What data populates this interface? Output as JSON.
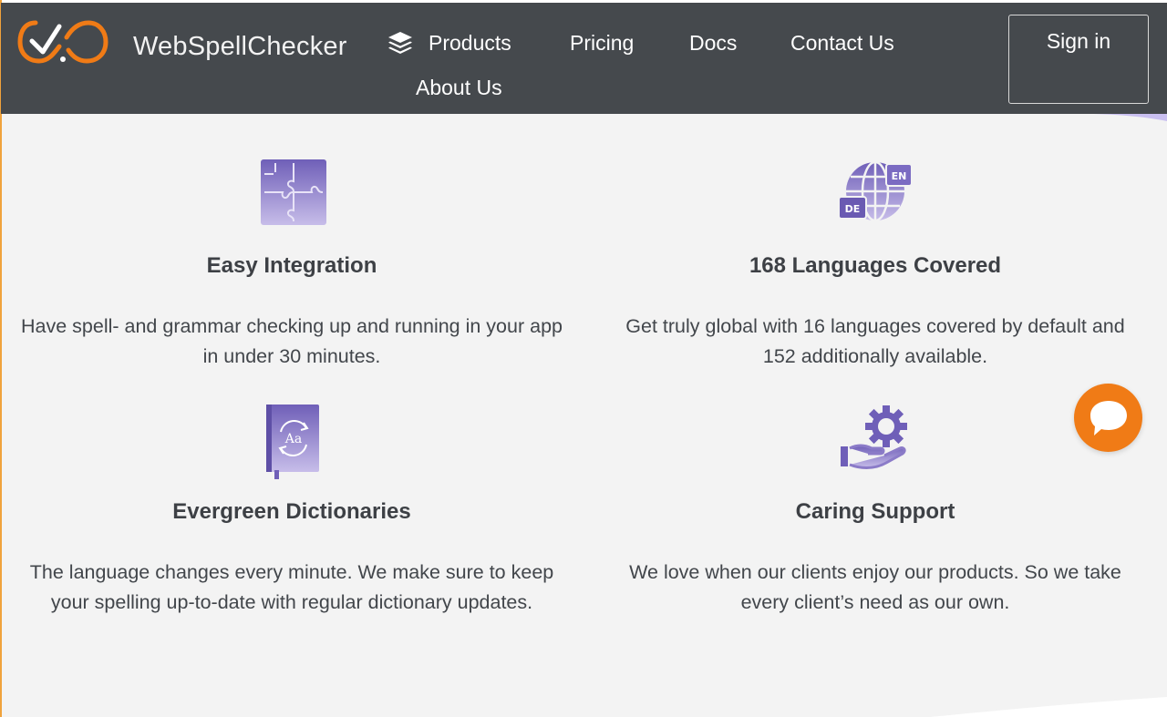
{
  "header": {
    "brand": "WebSpellChecker",
    "nav": {
      "products": "Products",
      "pricing": "Pricing",
      "docs": "Docs",
      "contact": "Contact Us",
      "about": "About Us"
    },
    "signin_label": "Sign in"
  },
  "features": [
    {
      "icon": "puzzle-icon",
      "title": "Easy Integration",
      "text_line1": "Have spell- and grammar checking up and running in your app",
      "text_line2": "in under 30 minutes."
    },
    {
      "icon": "globe-languages-icon",
      "badge_en": "EN",
      "badge_de": "DE",
      "title": "168 Languages Covered",
      "text_line1": "Get truly global with 16 languages covered by default and",
      "text_line2": "152 additionally available."
    },
    {
      "icon": "dictionary-icon",
      "book_label": "Aa",
      "title": "Evergreen Dictionaries",
      "text_line1": "The language changes every minute. We make sure to keep",
      "text_line2": "your spelling up-to-date with regular dictionary updates."
    },
    {
      "icon": "support-gear-hand-icon",
      "title": "Caring Support",
      "text_line1": "We love when our clients enjoy our products. So we take",
      "text_line2": "every client’s need as our own."
    }
  ],
  "colors": {
    "header_bg": "#45494d",
    "accent_orange": "#f07b16",
    "icon_purple": "#8b7bc8",
    "page_bg": "#f3f3f3"
  }
}
